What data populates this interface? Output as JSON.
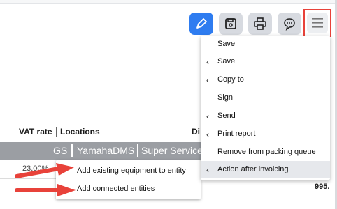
{
  "toolbar": {
    "buttons": [
      {
        "name": "edit-button",
        "icon": "pen-icon"
      },
      {
        "name": "save-button",
        "icon": "floppy-disk-icon"
      },
      {
        "name": "print-button",
        "icon": "printer-icon"
      },
      {
        "name": "comment-button",
        "icon": "chat-bubble-icon"
      },
      {
        "name": "menu-button",
        "icon": "hamburger-icon"
      }
    ],
    "accent": "#2e7cf0",
    "highlight": "#e8423a"
  },
  "table": {
    "headers": {
      "vat_rate": "VAT rate",
      "locations": "Locations",
      "di": "Di"
    },
    "group_band": [
      "GS",
      "YamahaDMS",
      "Super Service"
    ],
    "partial_value": "23.00%",
    "right_value": "995."
  },
  "dropdown_menu": {
    "items": [
      {
        "label": "Save",
        "submenu": false
      },
      {
        "label": "Save",
        "submenu": true
      },
      {
        "label": "Copy to",
        "submenu": true
      },
      {
        "label": "Sign",
        "submenu": false
      },
      {
        "label": "Send",
        "submenu": true
      },
      {
        "label": "Print report",
        "submenu": true
      },
      {
        "label": "Remove from packing queue",
        "submenu": false
      },
      {
        "label": "Action after invoicing",
        "submenu": true,
        "active": true
      }
    ]
  },
  "context_menu": {
    "items": [
      {
        "label": "Add existing equipment to entity"
      },
      {
        "label": "Add connected entities"
      }
    ]
  }
}
